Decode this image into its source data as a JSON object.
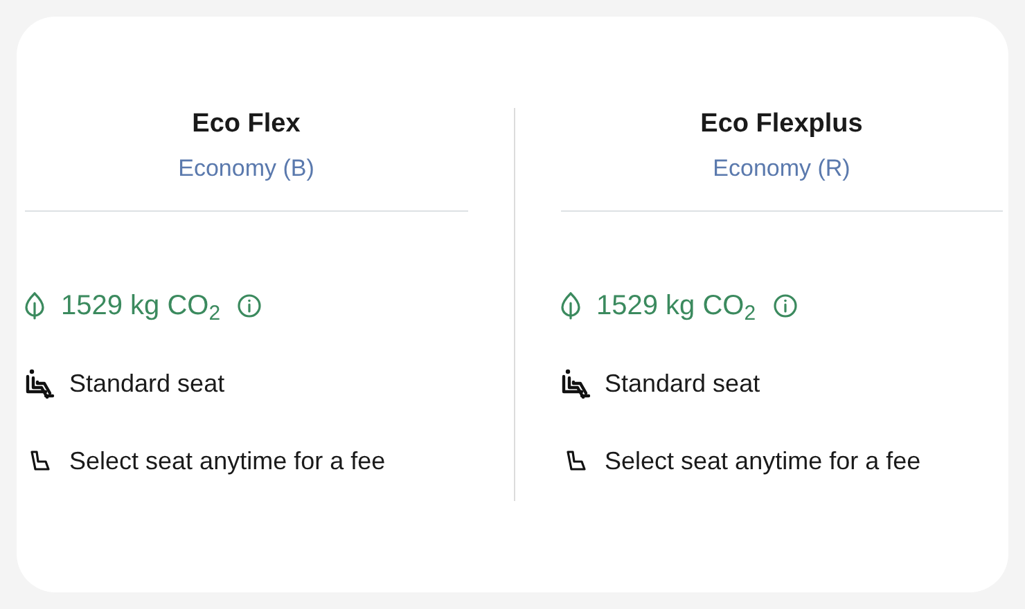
{
  "fares": [
    {
      "name": "Eco Flex",
      "cabin": "Economy (B)",
      "emissions": "1529 kg CO$_{2}$",
      "features": [
        {
          "kind": "standard-seat",
          "text": "Standard seat"
        },
        {
          "kind": "seat-selection",
          "text": "Select seat anytime for a fee"
        }
      ]
    },
    {
      "name": "Eco Flexplus",
      "cabin": "Economy (R)",
      "emissions": "1529 kg CO$_{2}$",
      "features": [
        {
          "kind": "standard-seat",
          "text": "Standard seat"
        },
        {
          "kind": "seat-selection",
          "text": "Select seat anytime for a fee"
        }
      ]
    }
  ]
}
